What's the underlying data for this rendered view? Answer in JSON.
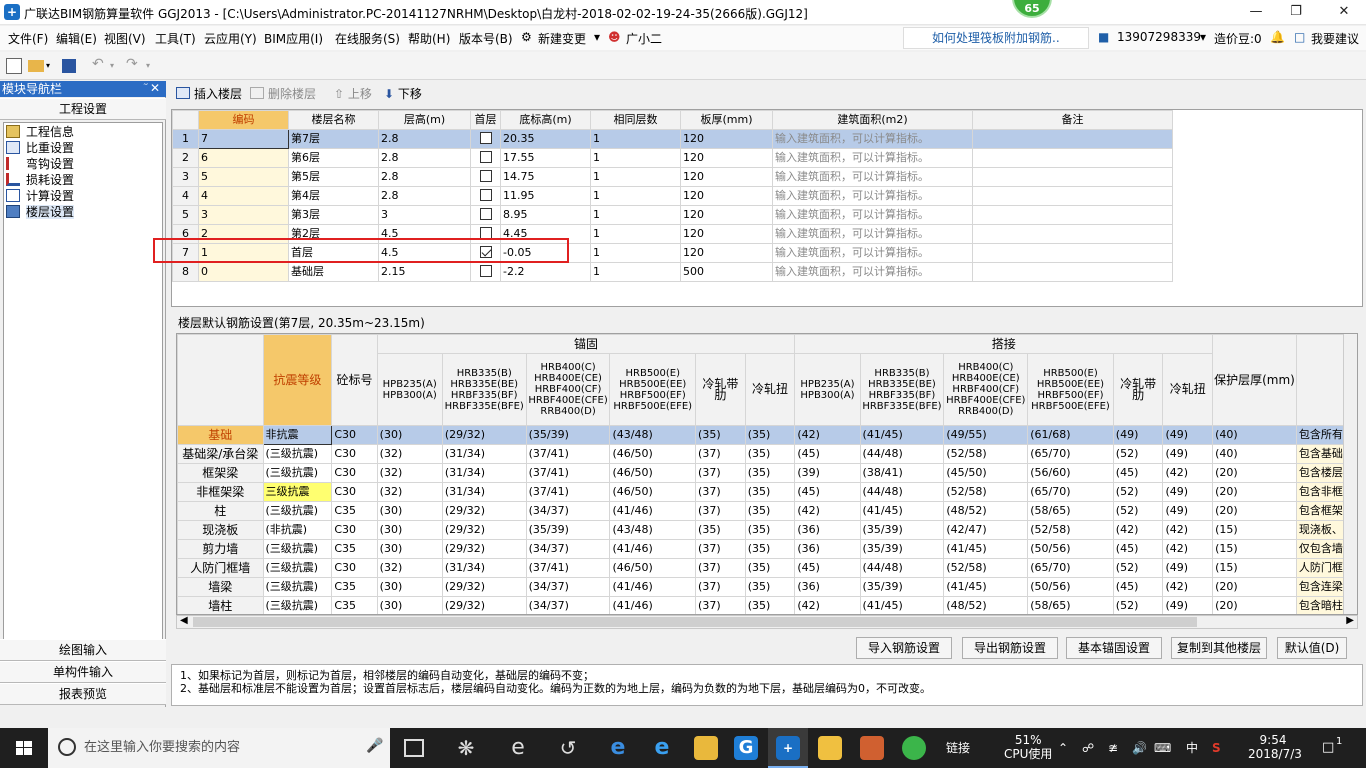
{
  "window": {
    "title": "广联达BIM钢筋算量软件 GGJ2013 - [C:\\Users\\Administrator.PC-20141127NRHM\\Desktop\\白龙村-2018-02-02-19-24-35(2666版).GGJ12]",
    "badge": "65"
  },
  "menu": [
    "文件(F)",
    "编辑(E)",
    "视图(V)",
    "工具(T)",
    "云应用(Y)",
    "BIM应用(I)",
    "在线服务(S)",
    "帮助(H)",
    "版本号(B)",
    "新建变更",
    "广小二"
  ],
  "menu_right": {
    "notice": "如何处理筏板附加钢筋..",
    "phone": "13907298339",
    "zaojia": "造价豆:0",
    "suggest": "我要建议"
  },
  "left_panel": {
    "title": "模块导航栏",
    "section": "工程设置",
    "tree": [
      "工程信息",
      "比重设置",
      "弯钩设置",
      "损耗设置",
      "计算设置",
      "楼层设置"
    ],
    "bottom_tabs": [
      "绘图输入",
      "单构件输入",
      "报表预览"
    ]
  },
  "main_toolbar": {
    "insert": "插入楼层",
    "delete": "删除楼层",
    "up": "上移",
    "down": "下移"
  },
  "floor_table": {
    "headers": [
      "编码",
      "楼层名称",
      "层高(m)",
      "首层",
      "底标高(m)",
      "相同层数",
      "板厚(mm)",
      "建筑面积(m2)",
      "备注"
    ],
    "placeholder": "输入建筑面积，可以计算指标。",
    "rows": [
      {
        "n": "1",
        "code": "7",
        "name": "第7层",
        "height": "2.8",
        "first": false,
        "base": "20.35",
        "same": "1",
        "thick": "120"
      },
      {
        "n": "2",
        "code": "6",
        "name": "第6层",
        "height": "2.8",
        "first": false,
        "base": "17.55",
        "same": "1",
        "thick": "120"
      },
      {
        "n": "3",
        "code": "5",
        "name": "第5层",
        "height": "2.8",
        "first": false,
        "base": "14.75",
        "same": "1",
        "thick": "120"
      },
      {
        "n": "4",
        "code": "4",
        "name": "第4层",
        "height": "2.8",
        "first": false,
        "base": "11.95",
        "same": "1",
        "thick": "120"
      },
      {
        "n": "5",
        "code": "3",
        "name": "第3层",
        "height": "3",
        "first": false,
        "base": "8.95",
        "same": "1",
        "thick": "120"
      },
      {
        "n": "6",
        "code": "2",
        "name": "第2层",
        "height": "4.5",
        "first": false,
        "base": "4.45",
        "same": "1",
        "thick": "120"
      },
      {
        "n": "7",
        "code": "1",
        "name": "首层",
        "height": "4.5",
        "first": true,
        "base": "-0.05",
        "same": "1",
        "thick": "120"
      },
      {
        "n": "8",
        "code": "0",
        "name": "基础层",
        "height": "2.15",
        "first": false,
        "base": "-2.2",
        "same": "1",
        "thick": "500"
      }
    ]
  },
  "rebar_section": {
    "title": "楼层默认钢筋设置(第7层, 20.35m~23.15m)",
    "group_anchor": "锚固",
    "group_lap": "搭接",
    "h_seismic": "抗震等级",
    "h_concrete": "砼标号",
    "h_cover": "保护层厚(mm)",
    "steel_heads": [
      "HPB235(A) HPB300(A)",
      "HRB335(B) HRB335E(BE) HRBF335(BF) HRBF335E(BFE)",
      "HRB400(C) HRB400E(CE) HRBF400(CF) HRBF400E(CFE) RRB400(D)",
      "HRB500(E) HRB500E(EE) HRBF500(EF) HRBF500E(EFE)",
      "冷轧带肋",
      "冷轧扭"
    ],
    "rows": [
      {
        "label": "基础",
        "seismic": "非抗震",
        "c": "C30",
        "a": [
          "(30)",
          "(29/32)",
          "(35/39)",
          "(43/48)",
          "(35)",
          "(35)"
        ],
        "l": [
          "(42)",
          "(41/45)",
          "(49/55)",
          "(61/68)",
          "(49)",
          "(49)"
        ],
        "cover": "(40)",
        "note": "包含所有的"
      },
      {
        "label": "基础梁/承台梁",
        "seismic": "(三级抗震)",
        "c": "C30",
        "a": [
          "(32)",
          "(31/34)",
          "(37/41)",
          "(46/50)",
          "(37)",
          "(35)"
        ],
        "l": [
          "(45)",
          "(44/48)",
          "(52/58)",
          "(65/70)",
          "(52)",
          "(49)"
        ],
        "cover": "(40)",
        "note": "包含基础主"
      },
      {
        "label": "框架梁",
        "seismic": "(三级抗震)",
        "c": "C30",
        "a": [
          "(32)",
          "(31/34)",
          "(37/41)",
          "(46/50)",
          "(37)",
          "(35)"
        ],
        "l": [
          "(39)",
          "(38/41)",
          "(45/50)",
          "(56/60)",
          "(45)",
          "(42)"
        ],
        "cover": "(20)",
        "note": "包含楼层框"
      },
      {
        "label": "非框架梁",
        "seismic": "三级抗震",
        "c": "C30",
        "a": [
          "(32)",
          "(31/34)",
          "(37/41)",
          "(46/50)",
          "(37)",
          "(35)"
        ],
        "l": [
          "(45)",
          "(44/48)",
          "(52/58)",
          "(65/70)",
          "(52)",
          "(49)"
        ],
        "cover": "(20)",
        "note": "包含非框架"
      },
      {
        "label": "柱",
        "seismic": "(三级抗震)",
        "c": "C35",
        "a": [
          "(30)",
          "(29/32)",
          "(34/37)",
          "(41/46)",
          "(37)",
          "(35)"
        ],
        "l": [
          "(42)",
          "(41/45)",
          "(48/52)",
          "(58/65)",
          "(52)",
          "(49)"
        ],
        "cover": "(20)",
        "note": "包含框架柱"
      },
      {
        "label": "现浇板",
        "seismic": "(非抗震)",
        "c": "C30",
        "a": [
          "(30)",
          "(29/32)",
          "(35/39)",
          "(43/48)",
          "(35)",
          "(35)"
        ],
        "l": [
          "(36)",
          "(35/39)",
          "(42/47)",
          "(52/58)",
          "(42)",
          "(42)"
        ],
        "cover": "(15)",
        "note": "现浇板、螺"
      },
      {
        "label": "剪力墙",
        "seismic": "(三级抗震)",
        "c": "C35",
        "a": [
          "(30)",
          "(29/32)",
          "(34/37)",
          "(41/46)",
          "(37)",
          "(35)"
        ],
        "l": [
          "(36)",
          "(35/39)",
          "(41/45)",
          "(50/56)",
          "(45)",
          "(42)"
        ],
        "cover": "(15)",
        "note": "仅包含墙身"
      },
      {
        "label": "人防门框墙",
        "seismic": "(三级抗震)",
        "c": "C30",
        "a": [
          "(32)",
          "(31/34)",
          "(37/41)",
          "(46/50)",
          "(37)",
          "(35)"
        ],
        "l": [
          "(45)",
          "(44/48)",
          "(52/58)",
          "(65/70)",
          "(52)",
          "(49)"
        ],
        "cover": "(15)",
        "note": "人防门框墙"
      },
      {
        "label": "墙梁",
        "seismic": "(三级抗震)",
        "c": "C35",
        "a": [
          "(30)",
          "(29/32)",
          "(34/37)",
          "(41/46)",
          "(37)",
          "(35)"
        ],
        "l": [
          "(36)",
          "(35/39)",
          "(41/45)",
          "(50/56)",
          "(45)",
          "(42)"
        ],
        "cover": "(20)",
        "note": "包含连梁、"
      },
      {
        "label": "墙柱",
        "seismic": "(三级抗震)",
        "c": "C35",
        "a": [
          "(30)",
          "(29/32)",
          "(34/37)",
          "(41/46)",
          "(37)",
          "(35)"
        ],
        "l": [
          "(42)",
          "(41/45)",
          "(48/52)",
          "(58/65)",
          "(52)",
          "(49)"
        ],
        "cover": "(20)",
        "note": "包含暗柱、"
      }
    ]
  },
  "bottom_buttons": [
    "导入钢筋设置",
    "导出钢筋设置",
    "基本锚固设置",
    "复制到其他楼层",
    "默认值(D)"
  ],
  "notes": [
    "1、如果标记为首层，则标记为首层，相邻楼层的编码自动变化，基础层的编码不变；",
    "2、基础层和标准层不能设置为首层；设置首层标志后，楼层编码自动变化。编码为正数的为地上层，编码为负数的为地下层，基础层编码为0，不可改变。"
  ],
  "taskbar": {
    "search": "在这里输入你要搜索的内容",
    "link": "链接",
    "cpu": "51%",
    "cpu_label": "CPU使用",
    "ime": "中",
    "time": "9:54",
    "date": "2018/7/3",
    "notif": "1"
  }
}
